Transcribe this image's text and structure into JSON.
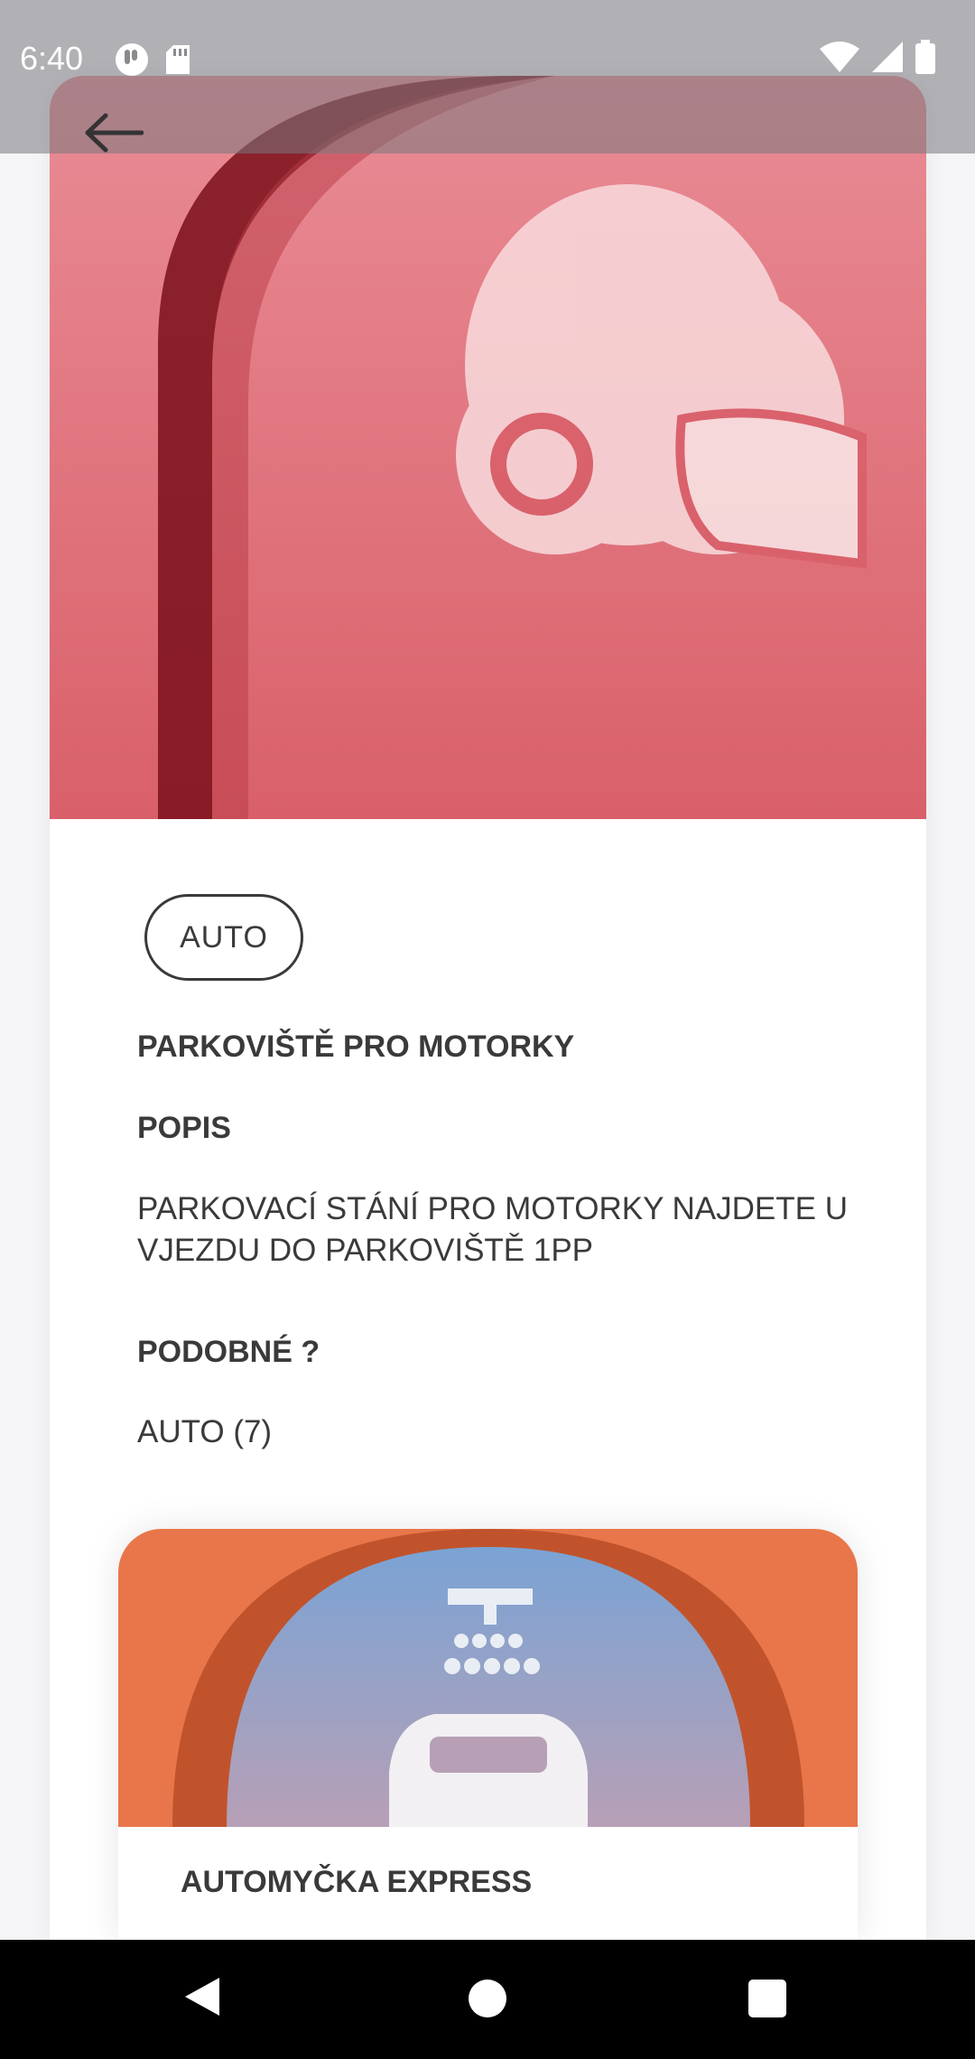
{
  "status_bar": {
    "time": "6:40",
    "left_icons": [
      "app-notification-icon",
      "sd-card-icon"
    ],
    "right_icons": [
      "wifi-icon",
      "cell-signal-icon",
      "battery-icon"
    ]
  },
  "detail": {
    "hero_icon": "motorcycle-helmet-icon",
    "category_chip": "AUTO",
    "title": "PARKOVIŠTĚ PRO MOTORKY",
    "description_label": "POPIS",
    "description": "PARKOVACÍ STÁNÍ PRO MOTORKY NAJDETE U VJEZDU DO PARKOVIŠTĚ 1PP",
    "similar_label": "PODOBNÉ ?",
    "similar_link": "AUTO (7)"
  },
  "similar_items": [
    {
      "title": "AUTOMYČKA EXPRESS",
      "icon": "car-wash-icon"
    }
  ],
  "colors": {
    "hero_background": "#d95f6b",
    "card_background": "#e8764a",
    "text": "#3a3a3a"
  }
}
